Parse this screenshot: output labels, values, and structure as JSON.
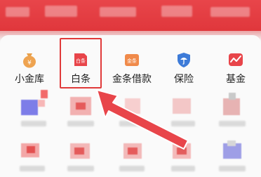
{
  "menu": {
    "items": [
      {
        "label": "小金库",
        "icon": "money-bag-icon",
        "color": "#e8a04a"
      },
      {
        "label": "白条",
        "icon": "baitiao-card-icon",
        "icon_text": "白条",
        "color": "#e8454a"
      },
      {
        "label": "金条借款",
        "icon": "jintiao-loan-icon",
        "icon_text": "金条",
        "color": "#f08a4a"
      },
      {
        "label": "保险",
        "icon": "shield-umbrella-icon",
        "color": "#3d7bd8"
      },
      {
        "label": "基金",
        "icon": "fund-chart-icon",
        "color": "#e8454a"
      }
    ]
  },
  "annotation": {
    "highlight_color": "#e03a3a"
  },
  "colors": {
    "header": "#e0373c",
    "background": "#fafafa"
  }
}
